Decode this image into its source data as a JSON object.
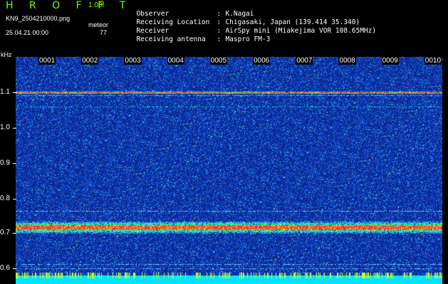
{
  "app": {
    "logo": "H R O F F T",
    "version": "1.00f",
    "filename": "KN9_2504210000.png",
    "datetime": "25.04.21 00:00",
    "meteor_label": "meteor",
    "meteor_count": "77"
  },
  "meta": [
    {
      "key": "Observer",
      "value": "K.Nagai"
    },
    {
      "key": "Receiving Location",
      "value": "Chigasaki, Japan (139.414 35.340)"
    },
    {
      "key": "Receiver",
      "value": "AirSpy mini (Miakejima VOR 108.65MHz)"
    },
    {
      "key": "Receiving antenna",
      "value": "Maspro FM-3"
    }
  ],
  "axis": {
    "unit": "kHz",
    "y_ticks": [
      "1.1",
      "1.0",
      "0.9",
      "0.8",
      "0.7",
      "0.6"
    ],
    "x_ticks": [
      "0001",
      "0002",
      "0003",
      "0004",
      "0005",
      "0006",
      "0007",
      "0008",
      "0009",
      "0010"
    ]
  },
  "colors": {
    "background": "#0a2a9a",
    "noise": "#1e6cff",
    "band_hot": "#ff2040",
    "band_warm": "#20ff60",
    "logo": "#7cfc00",
    "baseline": "#00e5ff"
  }
}
